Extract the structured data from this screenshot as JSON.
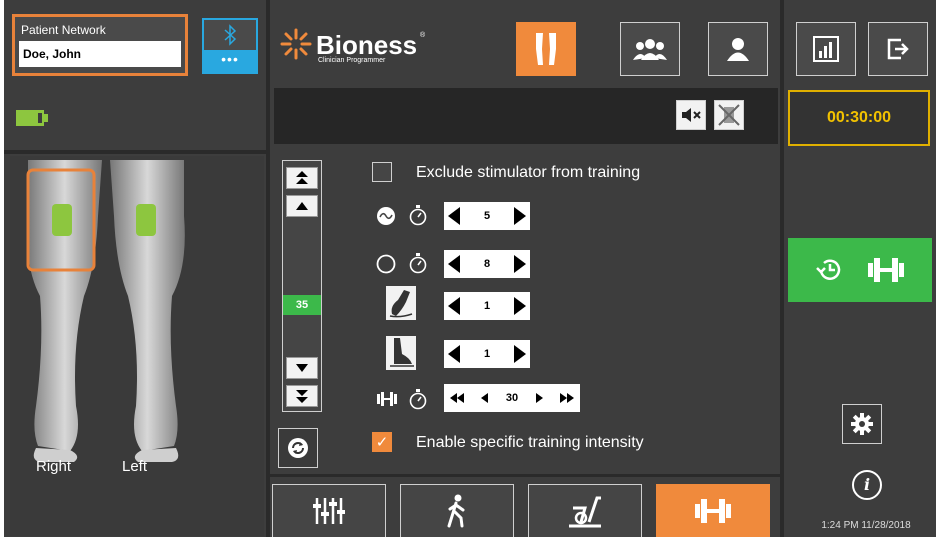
{
  "patient": {
    "network_label": "Patient Network",
    "name": "Doe, John"
  },
  "bluetooth": {
    "dots": "•••"
  },
  "brand": {
    "name": "Bioness",
    "registered": "®",
    "subtitle": "Clinician Programmer",
    "accent_color": "#f08a3c"
  },
  "timer": {
    "value": "00:30:00",
    "color": "#f2c200"
  },
  "legs": {
    "right_label": "Right",
    "left_label": "Left"
  },
  "level": {
    "value": "35",
    "color": "#3cb94a"
  },
  "settings": {
    "exclude_label": "Exclude stimulator from training",
    "exclude_checked": false,
    "ramp_on_value": "5",
    "ramp_off_value": "8",
    "heel_off_value": "1",
    "heel_on_value": "1",
    "training_time_value": "30",
    "enable_label": "Enable specific training intensity",
    "enable_checked": true,
    "check_mark": "✓"
  },
  "icons": {
    "info_glyph": "i"
  },
  "status": {
    "datetime": "1:24 PM 11/28/2018"
  }
}
